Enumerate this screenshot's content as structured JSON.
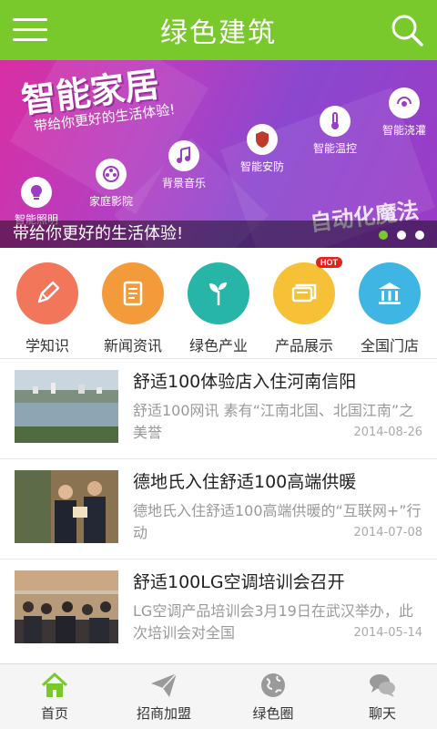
{
  "header": {
    "title": "绿色建筑"
  },
  "banner": {
    "headline": "智能家居",
    "subline": "带给你更好的生活体验!",
    "features": [
      "智能照明",
      "家庭影院",
      "背景音乐",
      "智能安防",
      "智能温控",
      "智能浇灌"
    ],
    "tagline": "自动化魔法",
    "caption": "带给你更好的生活体验!",
    "active_slide": 1,
    "slide_count": 3
  },
  "categories": [
    {
      "label": "学知识",
      "color": "#f2765a",
      "icon": "pen-icon"
    },
    {
      "label": "新闻资讯",
      "color": "#f39a3b",
      "icon": "document-icon"
    },
    {
      "label": "绿色产业",
      "color": "#27b5a8",
      "icon": "sprout-icon"
    },
    {
      "label": "产品展示",
      "color": "#f6c137",
      "icon": "cards-icon",
      "badge": "HOT"
    },
    {
      "label": "全国门店",
      "color": "#3fb5e4",
      "icon": "bank-icon"
    }
  ],
  "news": [
    {
      "title": "舒适100体验店入住河南信阳",
      "desc": "舒适100网讯 素有“江南北国、北国江南”之美誉",
      "date": "2014-08-26"
    },
    {
      "title": "德地氏入住舒适100高端供暖",
      "desc": "德地氏入住舒适100高端供暖的“互联网+”行动",
      "date": "2014-07-08"
    },
    {
      "title": "舒适100LG空调培训会召开",
      "desc": "LG空调产品培训会3月19日在武汉举办，此次培训会对全国",
      "date": "2014-05-14"
    }
  ],
  "tabs": [
    {
      "label": "首页",
      "icon": "home-icon",
      "active": true
    },
    {
      "label": "招商加盟",
      "icon": "paper-plane-icon",
      "active": false
    },
    {
      "label": "绿色圈",
      "icon": "globe-icon",
      "active": false
    },
    {
      "label": "聊天",
      "icon": "chat-bubbles-icon",
      "active": false
    }
  ],
  "colors": {
    "brand": "#79c92c",
    "tab_active": "#79c92c",
    "tab_inactive": "#888888"
  }
}
